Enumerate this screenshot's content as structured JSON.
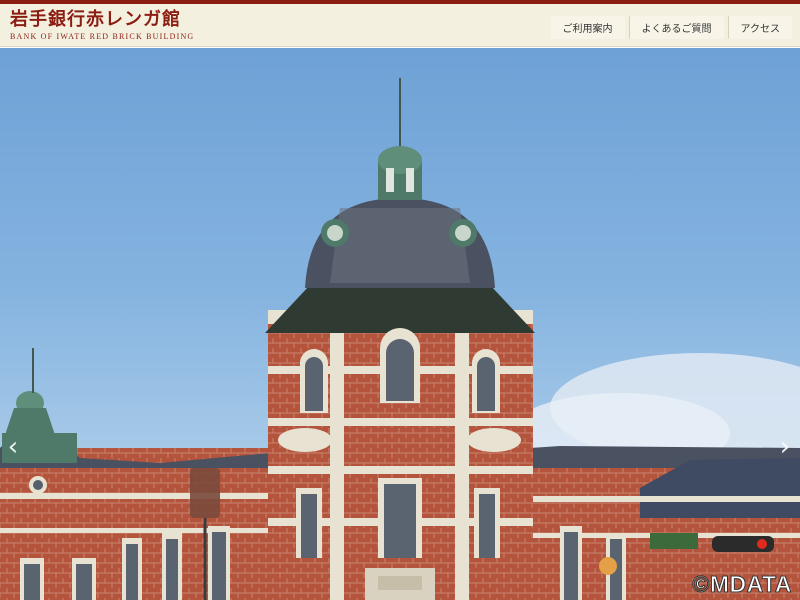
{
  "header": {
    "logo_title": "岩手銀行赤レンガ館",
    "logo_subtitle": "BANK OF IWATE RED BRICK BUILDING"
  },
  "nav": {
    "items": [
      {
        "label": "ご利用案内"
      },
      {
        "label": "よくあるご質問"
      },
      {
        "label": "アクセス"
      }
    ]
  },
  "hero": {
    "prev_glyph": "‹",
    "next_glyph": "›",
    "credit": "©MDATA"
  },
  "colors": {
    "brand": "#8b1d12",
    "header_bg": "#f4f0df",
    "sky": "#86b4e0",
    "brick": "#b5543c",
    "stone": "#e8e2d2",
    "roof_green": "#4f7a6a",
    "roof_dark": "#4a5160"
  }
}
